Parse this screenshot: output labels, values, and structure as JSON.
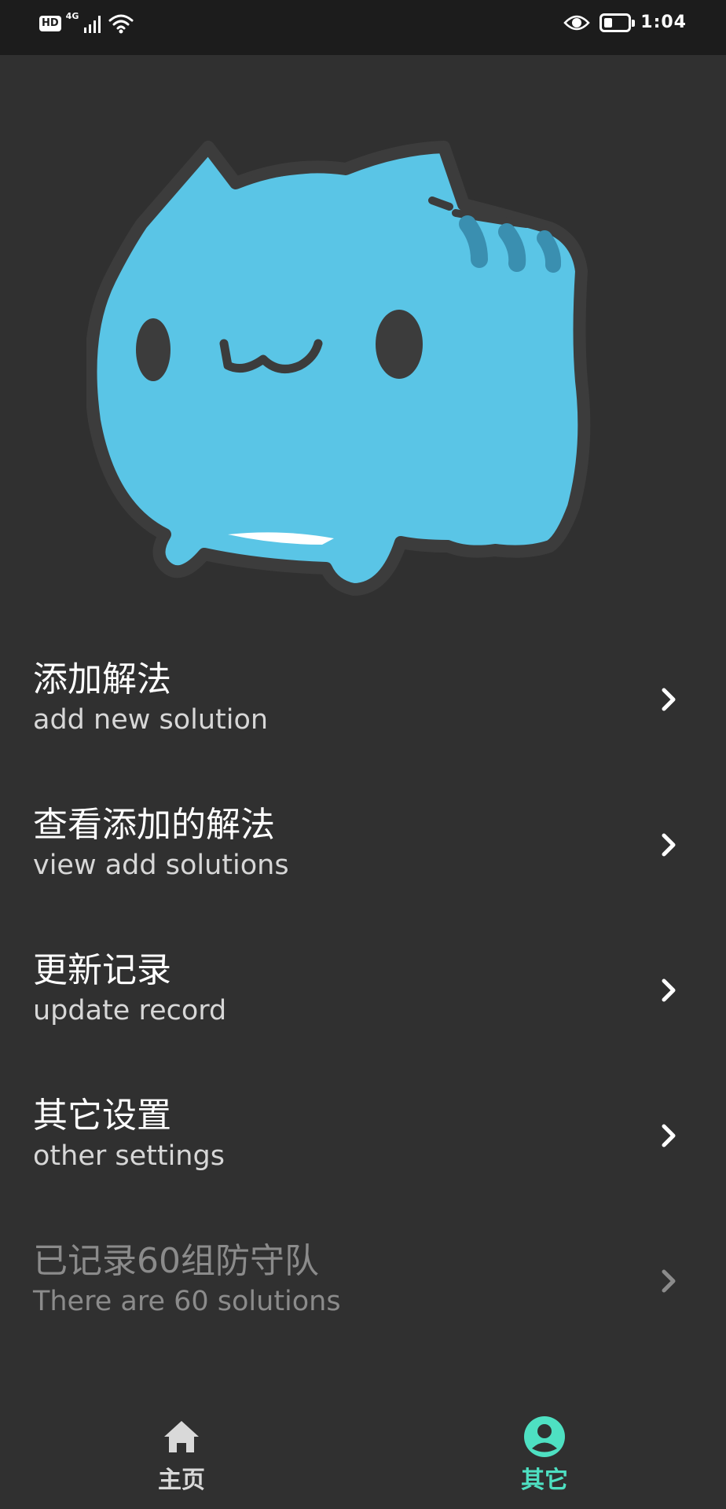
{
  "status_bar": {
    "hd": "HD",
    "network": "4G",
    "time": "1:04",
    "battery_level": 0.35,
    "icons": [
      "hd-icon",
      "signal-icon",
      "wifi-icon",
      "eye-icon",
      "battery-icon"
    ]
  },
  "hero": {
    "icon": "blue-cat-mascot-icon"
  },
  "menu": [
    {
      "title": "添加解法",
      "subtitle": "add new solution",
      "icon": "chevron-right-icon"
    },
    {
      "title": "查看添加的解法",
      "subtitle": "view add solutions",
      "icon": "chevron-right-icon"
    },
    {
      "title": "更新记录",
      "subtitle": "update record",
      "icon": "chevron-right-icon"
    },
    {
      "title": "其它设置",
      "subtitle": "other settings",
      "icon": "chevron-right-icon"
    },
    {
      "title": "已记录60组防守队",
      "subtitle": "There are 60 solutions",
      "icon": "chevron-right-icon",
      "disabled": true
    }
  ],
  "bottom_nav": {
    "home": {
      "label": "主页",
      "icon": "home-icon",
      "color": "#d9d9d9"
    },
    "other": {
      "label": "其它",
      "icon": "account-circle-icon",
      "color": "#4ee0c2",
      "active": true
    }
  },
  "colors": {
    "background": "#303030",
    "status_bar": "#1c1c1c",
    "accent": "#4ee0c2",
    "mascot_body": "#5ac5e6",
    "mascot_outline": "#3c3c3c"
  }
}
